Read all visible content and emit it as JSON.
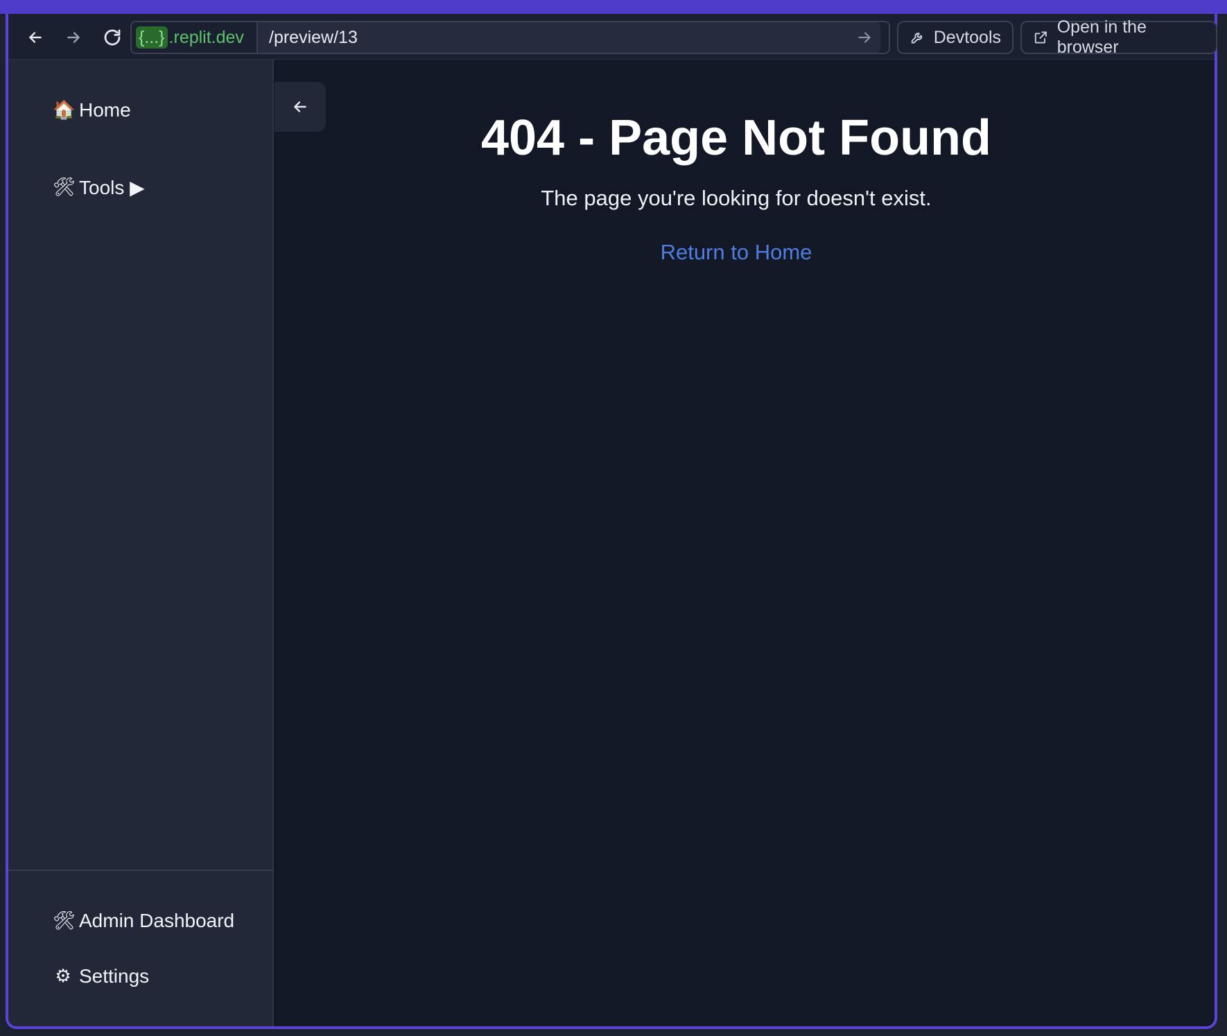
{
  "browser": {
    "domain_brace": "{...}",
    "domain_suffix": ".replit.dev",
    "path": "/preview/13",
    "devtools_label": "Devtools",
    "open_browser_label": "Open in the browser"
  },
  "sidebar": {
    "top_items": [
      {
        "icon": "🏠",
        "label": "Home"
      },
      {
        "icon": "🛠",
        "label": "Tools ▶"
      }
    ],
    "bottom_items": [
      {
        "icon": "🛠",
        "label": "Admin Dashboard"
      },
      {
        "icon": "⚙",
        "label": "Settings"
      }
    ]
  },
  "main": {
    "title": "404 - Page Not Found",
    "message": "The page you're looking for doesn't exist.",
    "link_label": "Return to Home"
  },
  "colors": {
    "accent": "#4f3cc9",
    "link": "#4f7ee0",
    "domain": "#5cc26a",
    "background": "#131827",
    "sidebar": "#232838"
  }
}
